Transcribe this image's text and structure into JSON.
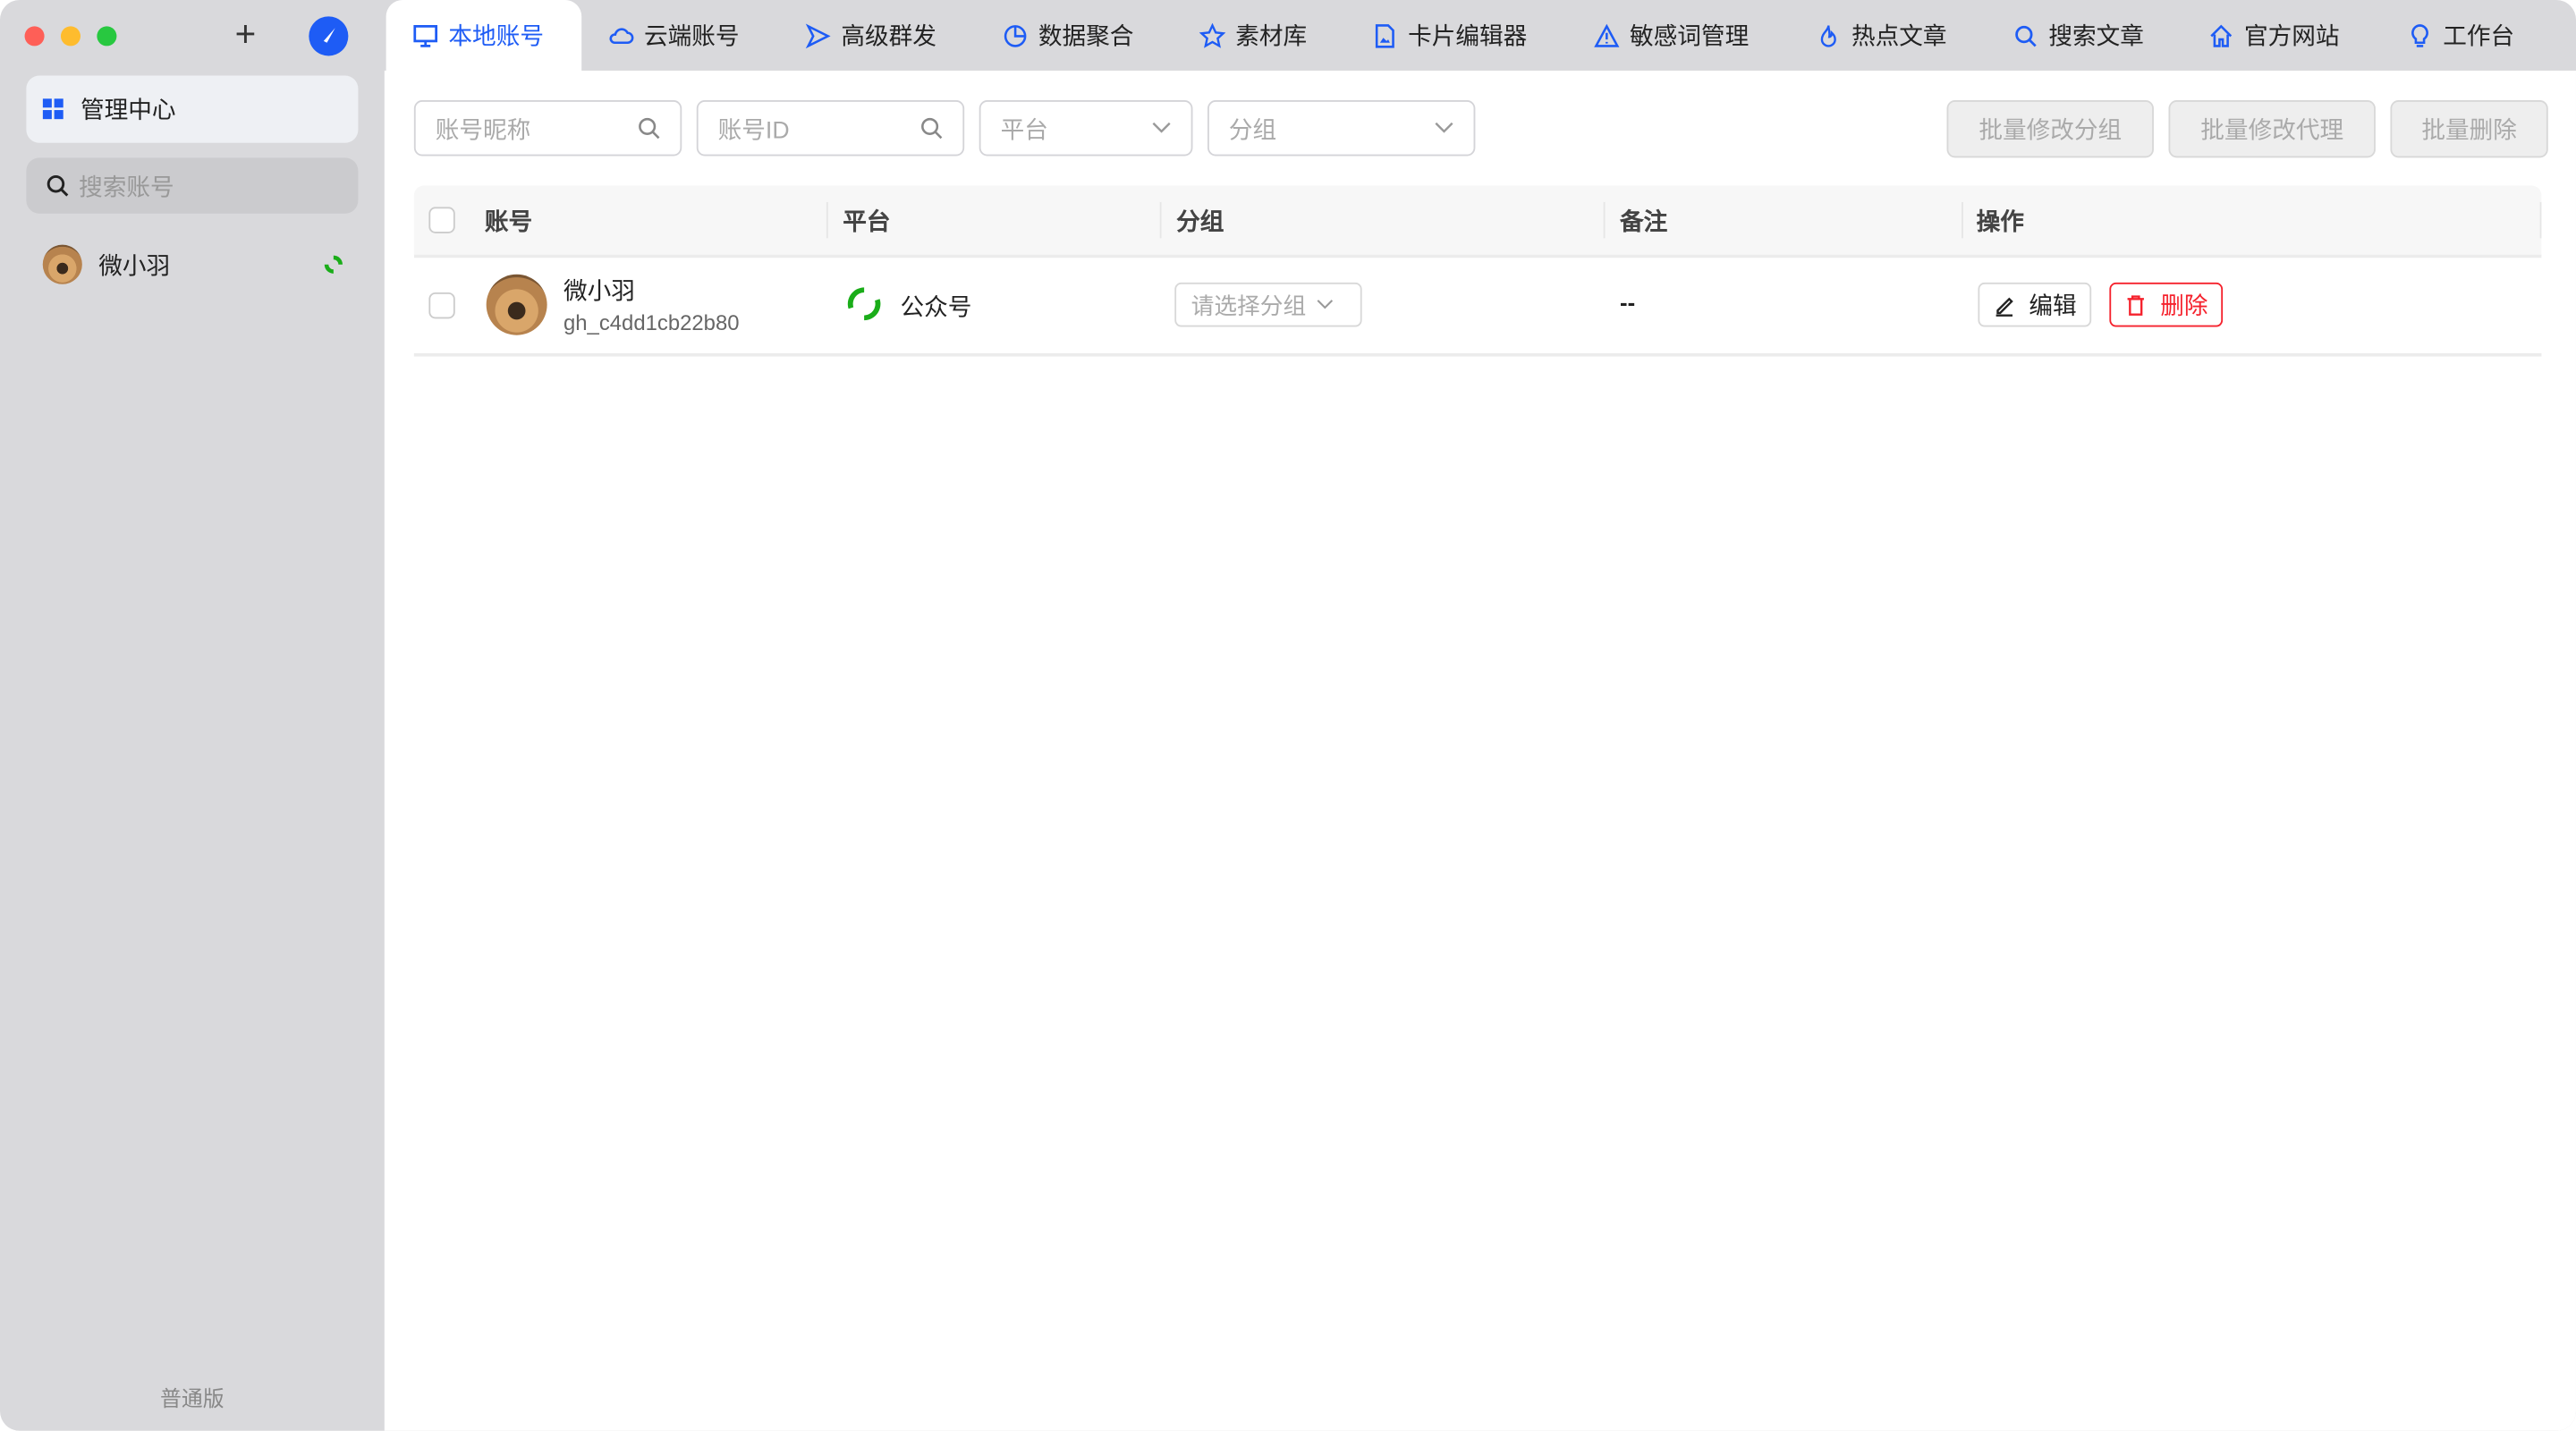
{
  "window": {
    "new_tab_label": "+"
  },
  "sidebar": {
    "nav_item": "管理中心",
    "search_placeholder": "搜索账号",
    "accounts": [
      {
        "name": "微小羽"
      }
    ],
    "edition": "普通版"
  },
  "tabs": [
    {
      "label": "本地账号",
      "icon": "monitor-icon",
      "active": true
    },
    {
      "label": "云端账号",
      "icon": "cloud-icon"
    },
    {
      "label": "高级群发",
      "icon": "send-icon"
    },
    {
      "label": "数据聚合",
      "icon": "pie-chart-icon"
    },
    {
      "label": "素材库",
      "icon": "star-icon"
    },
    {
      "label": "卡片编辑器",
      "icon": "file-image-icon"
    },
    {
      "label": "敏感词管理",
      "icon": "warning-icon"
    },
    {
      "label": "热点文章",
      "icon": "fire-icon"
    },
    {
      "label": "搜索文章",
      "icon": "search-icon"
    },
    {
      "label": "官方网站",
      "icon": "home-icon"
    },
    {
      "label": "工作台",
      "icon": "bulb-icon"
    }
  ],
  "filters": {
    "nickname_placeholder": "账号昵称",
    "id_placeholder": "账号ID",
    "platform_placeholder": "平台",
    "group_placeholder": "分组"
  },
  "bulk_actions": {
    "edit_group": "批量修改分组",
    "edit_proxy": "批量修改代理",
    "delete": "批量删除"
  },
  "table": {
    "columns": [
      "账号",
      "平台",
      "分组",
      "备注",
      "操作"
    ],
    "rows": [
      {
        "name": "微小羽",
        "id": "gh_c4dd1cb22b80",
        "platform": "公众号",
        "group_placeholder": "请选择分组",
        "note": "--",
        "edit": "编辑",
        "delete": "删除"
      }
    ]
  },
  "colors": {
    "accent": "#1e5cf5",
    "danger": "#f5222d",
    "wechat_green": "#1aad19"
  }
}
